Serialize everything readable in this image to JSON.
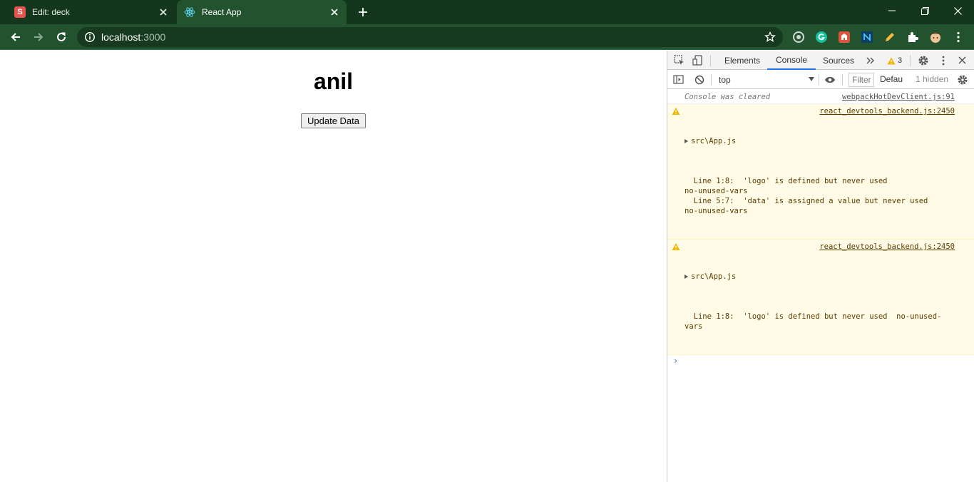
{
  "tabs": [
    {
      "title": "Edit: deck",
      "favicon": "S",
      "active": false
    },
    {
      "title": "React App",
      "active": true
    }
  ],
  "address": {
    "host": "localhost",
    "port": ":3000"
  },
  "page": {
    "heading": "anil",
    "button_label": "Update Data"
  },
  "devtools": {
    "tabs": [
      "Elements",
      "Console",
      "Sources"
    ],
    "active_tab": "Console",
    "warning_count": "3",
    "context": "top",
    "filter_placeholder": "Filter",
    "levels_label": "Defau",
    "hidden_label": "1 hidden",
    "messages": {
      "cleared": {
        "text": "Console was cleared",
        "source": "webpackHotDevClient.js:91"
      },
      "warn1": {
        "file": "src\\App.js",
        "source": "react_devtools_backend.js:2450",
        "detail": "  Line 1:8:  'logo' is defined but never used  \nno-unused-vars\n  Line 5:7:  'data' is assigned a value but never used  \nno-unused-vars"
      },
      "warn2": {
        "file": "src\\App.js",
        "source": "react_devtools_backend.js:2450",
        "detail": "  Line 1:8:  'logo' is defined but never used  no-unused-\nvars"
      }
    }
  },
  "colors": {
    "tabbar": "#13361d",
    "toolbar": "#23522f",
    "accent": "#1a73e8",
    "warn_bg": "#fffbe6"
  }
}
